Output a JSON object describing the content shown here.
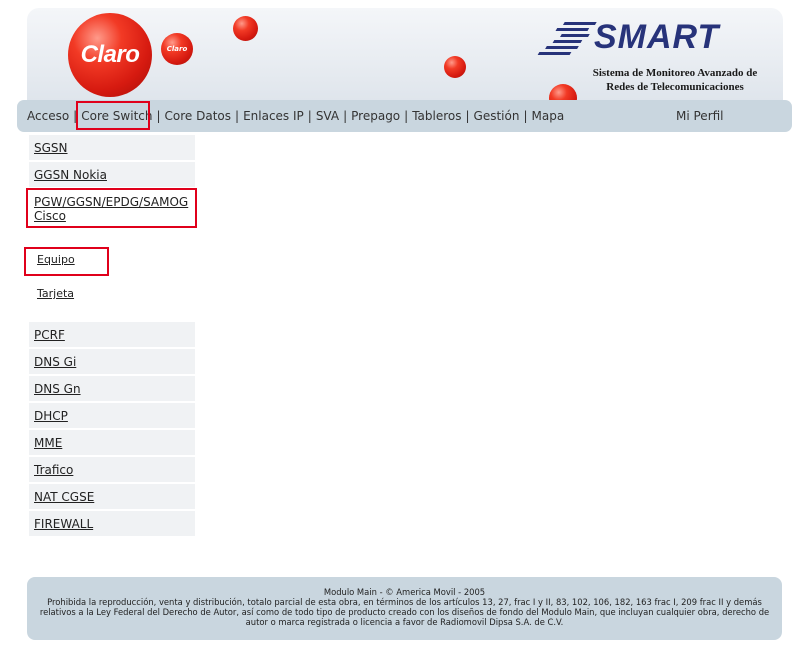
{
  "header": {
    "claro_logo_text": "Claro",
    "claro_small_text": "Claro",
    "smart_title": "SMART",
    "smart_subtitle_line1": "Sistema de Monitoreo Avanzado de",
    "smart_subtitle_line2": "Redes de Telecomunicaciones"
  },
  "nav": {
    "items": [
      "Acceso",
      "Core Switch",
      "Core Datos",
      "Enlaces IP",
      "SVA",
      "Prepago",
      "Tableros",
      "Gestión",
      "Mapa"
    ],
    "profile": "Mi Perfil"
  },
  "menu": {
    "items_top": [
      "SGSN",
      "GGSN Nokia"
    ],
    "selected_line1": "PGW/GGSN/EPDG/SAMOG",
    "selected_line2": "Cisco",
    "subitems": [
      "Equipo",
      "Tarjeta"
    ],
    "items_bottom": [
      "PCRF",
      "DNS Gi",
      "DNS Gn",
      "DHCP",
      "MME",
      "Trafico",
      "NAT CGSE",
      "FIREWALL"
    ]
  },
  "footer": {
    "line1": "Modulo Main - © America Movil - 2005",
    "line2": "Prohibida la reproducción, venta y distribución, totalo parcial de esta obra, en términos de los artículos 13, 27, frac I y II, 83, 102, 106, 182, 163 frac I, 209 frac II y demás relativos a la Ley Federal del Derecho de Autor, así como de todo tipo de producto creado con los diseños de fondo del Modulo Main, que incluyan cualquier obra, derecho de autor o marca registrada o licencia a favor de Radiomovil Dipsa S.A. de C.V."
  },
  "colors": {
    "brand_red": "#e3251a",
    "smart_blue": "#27337a",
    "nav_bg": "#c9d6df",
    "highlight": "#e0001b"
  }
}
